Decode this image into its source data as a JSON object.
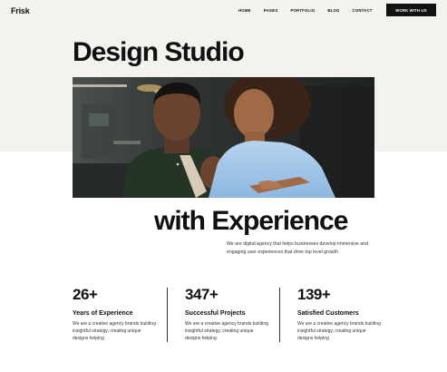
{
  "brand": {
    "logo": "Frisk"
  },
  "nav": {
    "items": [
      "HOME",
      "PAGES",
      "PORTFOLIO",
      "BLOG",
      "CONTACT"
    ],
    "cta_label": "WORK WITH US"
  },
  "hero": {
    "title_line1": "Design Studio",
    "title_line2": "with Experience",
    "description": "We are digital agency that helps businesses develop immersive and engaging user experiences that drive top level growth",
    "photo_alt": "two-people-looking-at-screen"
  },
  "stats": [
    {
      "value": "26+",
      "label": "Years of Experience",
      "text": "We are a creative agency brands building insightful strategy, creating unique designs helping"
    },
    {
      "value": "347+",
      "label": "Successful Projects",
      "text": "We are a creative agency brands building insightful strategy, creating unique designs helping"
    },
    {
      "value": "139+",
      "label": "Satisfied Customers",
      "text": "We are a creative agency brands building insightful strategy, creating unique designs helping"
    }
  ],
  "colors": {
    "hero_bg": "#f4f2ef",
    "accent": "#111111",
    "shirt_blue": "#9cc4e6"
  }
}
